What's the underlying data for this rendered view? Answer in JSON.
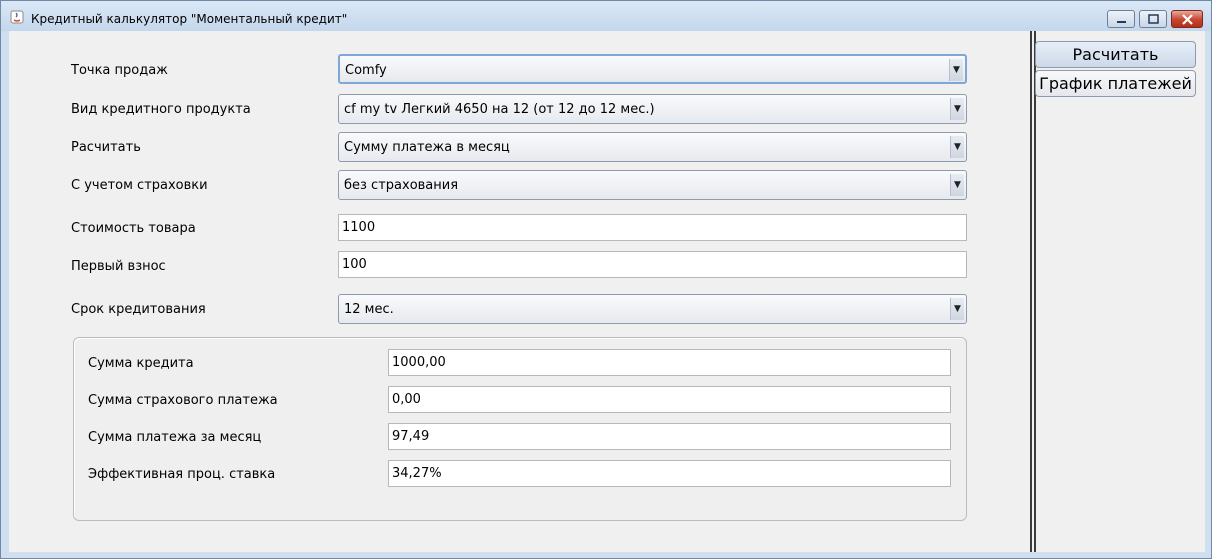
{
  "window": {
    "title": "Кредитный калькулятор \"Моментальный кредит\""
  },
  "form": {
    "point_of_sale": {
      "label": "Точка продаж",
      "value": "Comfy"
    },
    "credit_product": {
      "label": "Вид кредитного продукта",
      "value": "cf my tv Легкий 4650 на 12 (от 12 до 12 мес.)"
    },
    "calculate": {
      "label": "Расчитать",
      "value": "Сумму платежа в месяц"
    },
    "insurance": {
      "label": "С учетом страховки",
      "value": "без страхования"
    },
    "goods_price": {
      "label": "Стоимость товара",
      "value": "1100"
    },
    "down_payment": {
      "label": "Первый взнос",
      "value": "100"
    },
    "term": {
      "label": "Срок кредитования",
      "value": "12 мес."
    }
  },
  "results": {
    "loan_amount": {
      "label": "Сумма кредита",
      "value": "1000,00"
    },
    "insurance_payment": {
      "label": "Сумма страхового платежа",
      "value": "0,00"
    },
    "monthly_payment": {
      "label": "Сумма платежа за месяц",
      "value": "97,49"
    },
    "effective_rate": {
      "label": "Эффективная проц. ставка",
      "value": "34,27%"
    }
  },
  "side_tabs": [
    {
      "label": "Расчитать"
    },
    {
      "label": "График платежей"
    }
  ],
  "colors": {
    "frame": "#cfdff0",
    "client": "#f0f0f0",
    "close_button": "#c6452e",
    "focus_border": "#7ea7d8"
  }
}
